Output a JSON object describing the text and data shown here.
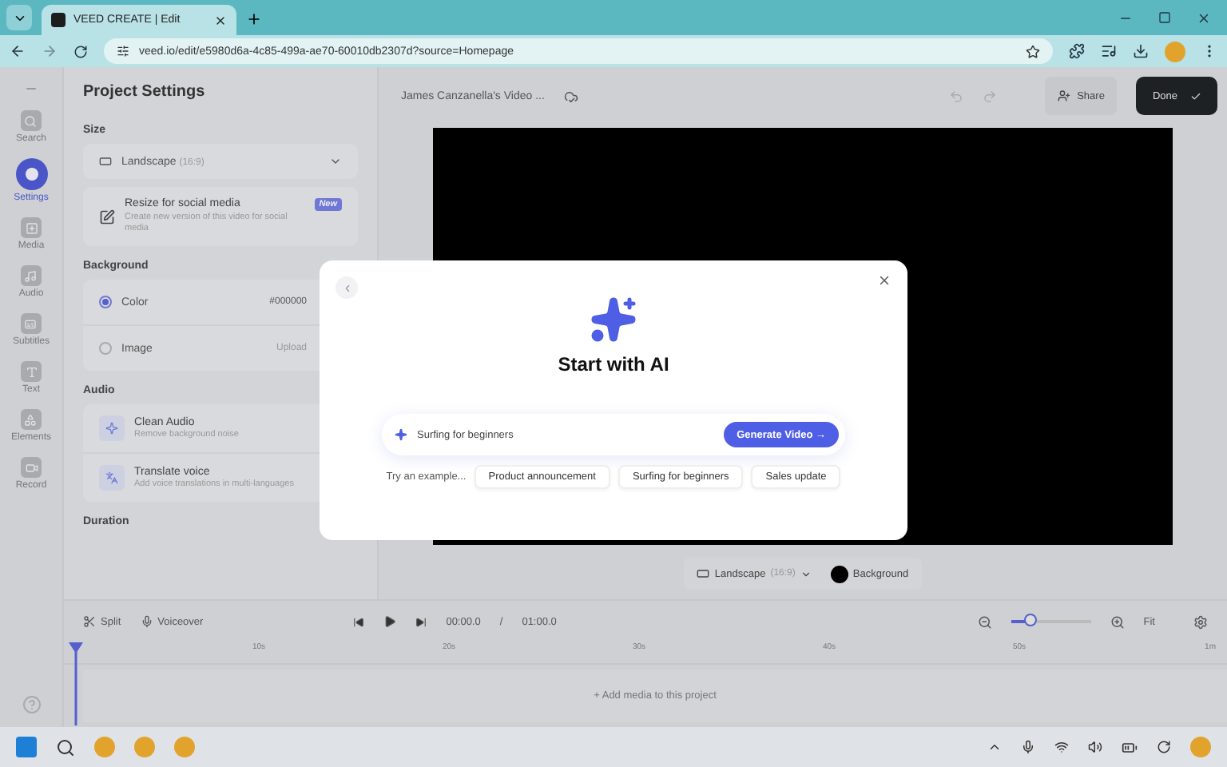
{
  "browser": {
    "tab_title": "VEED CREATE | Edit",
    "url": "veed.io/edit/e5980d6a-4c85-499a-ae70-60010db2307d?source=Homepage"
  },
  "rail": {
    "items": [
      {
        "label": "Search",
        "kind": "search",
        "selected": false
      },
      {
        "label": "Settings",
        "kind": "settings",
        "selected": true
      },
      {
        "label": "Media",
        "kind": "media",
        "selected": false
      },
      {
        "label": "Audio",
        "kind": "audio",
        "selected": false
      },
      {
        "label": "Subtitles",
        "kind": "subtitles",
        "selected": false
      },
      {
        "label": "Text",
        "kind": "text",
        "selected": false
      },
      {
        "label": "Elements",
        "kind": "elements",
        "selected": false
      },
      {
        "label": "Record",
        "kind": "record",
        "selected": false
      }
    ]
  },
  "settings": {
    "title": "Project Settings",
    "size_heading": "Size",
    "format": "Landscape",
    "ratio": "(16:9)",
    "resize_title": "Resize for social media",
    "resize_desc": "Create new version of this video for social media",
    "resize_badge": "New",
    "background_heading": "Background",
    "background_options": [
      {
        "label": "Color",
        "value": "#000000",
        "selected": true
      },
      {
        "label": "Image",
        "value": "Upload",
        "selected": false
      }
    ],
    "audio_heading": "Audio",
    "audio_items": [
      {
        "kind": "clean",
        "title": "Clean Audio",
        "desc": "Remove background noise"
      },
      {
        "kind": "translate",
        "title": "Translate voice",
        "desc": "Add voice translations in multi-languages"
      }
    ],
    "duration_heading": "Duration"
  },
  "toolbar": {
    "project_name": "James Canzanella's Video ...",
    "share": "Share",
    "done": "Done"
  },
  "canvas_bar": {
    "format": "Landscape",
    "ratio": "(16:9)",
    "background": "Background"
  },
  "timeline": {
    "split": "Split",
    "voiceover": "Voiceover",
    "current_time": "00:00.0",
    "separator": "/",
    "total_time": "01:00.0",
    "zoom": {
      "level": 0.25
    },
    "fit": "Fit",
    "ticks": [
      "10s",
      "20s",
      "30s",
      "40s",
      "50s",
      "1m"
    ],
    "add_media": "+ Add media to this project"
  },
  "modal": {
    "title": "Start with AI",
    "prompt": "Surfing for beginners",
    "generate": "Generate Video →",
    "examples_label": "Try an example...",
    "examples": [
      "Product announcement",
      "Surfing for beginners",
      "Sales update"
    ]
  }
}
